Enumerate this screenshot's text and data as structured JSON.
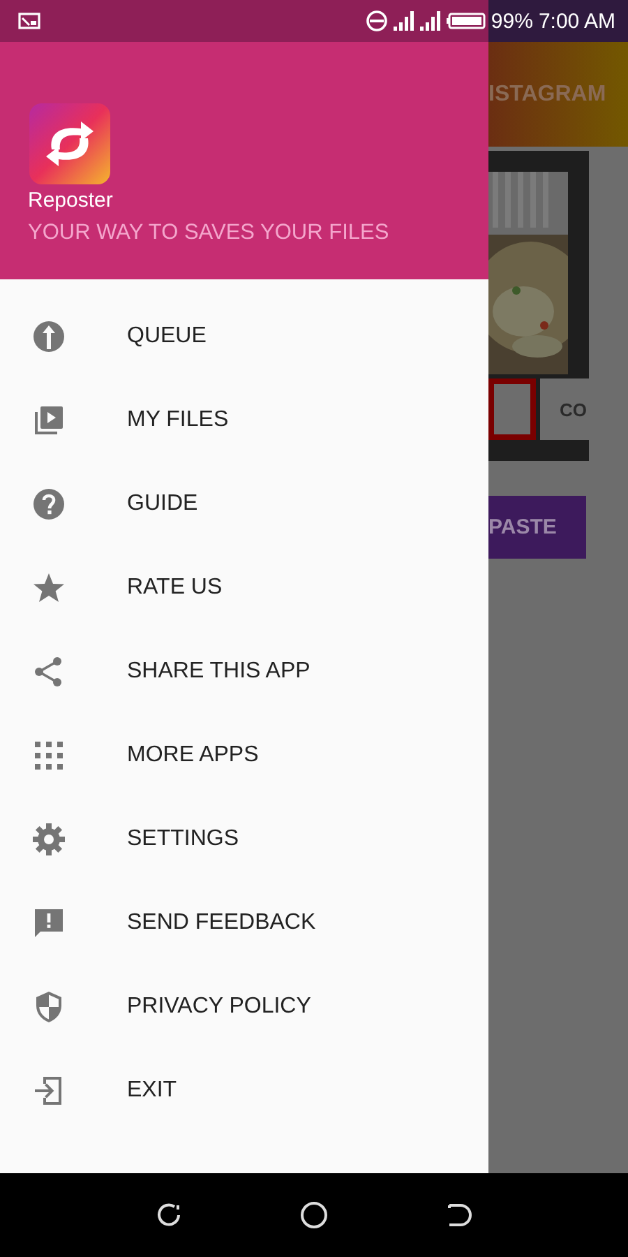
{
  "status_bar": {
    "battery": "99%",
    "time": "7:00 AM"
  },
  "drawer": {
    "app_name": "Reposter",
    "tagline": "YOUR WAY TO SAVES YOUR FILES",
    "items": [
      {
        "label": "QUEUE"
      },
      {
        "label": "MY FILES"
      },
      {
        "label": "GUIDE"
      },
      {
        "label": "RATE US"
      },
      {
        "label": "SHARE THIS APP"
      },
      {
        "label": "MORE APPS"
      },
      {
        "label": "SETTINGS"
      },
      {
        "label": "SEND FEEDBACK"
      },
      {
        "label": "PRIVACY POLICY"
      },
      {
        "label": "EXIT"
      }
    ]
  },
  "background_screen": {
    "toolbar_title": "ISTAGRAM",
    "copy_button": "CO",
    "paste_button": "PASTE"
  }
}
